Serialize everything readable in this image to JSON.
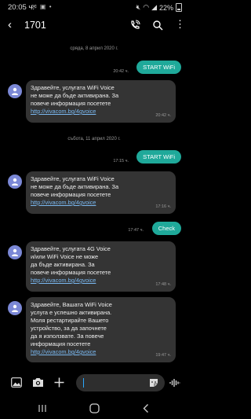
{
  "status": {
    "time": "20:05 ч.",
    "battery": "22%"
  },
  "header": {
    "back_glyph": "‹",
    "title": "1701"
  },
  "conversation": {
    "date1": "сряда, 8 април 2020 г.",
    "start1": {
      "text": "START WiFi",
      "time": "20:42 ч."
    },
    "msg1": {
      "lines": [
        "Здравейте, услугата WiFi Voice",
        "не може да бъде активирана. За",
        "повече информация посетете"
      ],
      "link": "http://vivacom.bg/4gvoice",
      "time": "20:42 ч."
    },
    "date2": "събота, 11 април 2020 г.",
    "start2": {
      "text": "START WiFi",
      "time": "17:15 ч."
    },
    "msg2": {
      "lines": [
        "Здравейте, услугата WiFi Voice",
        "не може да бъде активирана. За",
        "повече информация посетете"
      ],
      "link": "http://vivacom.bg/4gvoice",
      "time": "17:16 ч."
    },
    "check": {
      "text": "Check",
      "time": "17:47 ч."
    },
    "msg3": {
      "lines": [
        "Здравейте, услугата 4G Voice",
        "и/или WiFi Voice  не може",
        "да бъде активирана. За",
        "повече информация посетете"
      ],
      "link": "http://vivacom.bg/4gvoice",
      "time": "17:48 ч."
    },
    "msg4": {
      "lines": [
        "Здравейте, Вашата WiFi Voice",
        "услуга е успешно активирана.",
        "Моля рестартирайте Вашето",
        "устройство, за да започнете",
        "да я използвате. За повече",
        "информация посетете"
      ],
      "link": "http://vivacom.bg/4gvoice",
      "time": "19:47 ч."
    }
  },
  "icons": {
    "back": "back-arrow-icon",
    "call": "wifi-call-icon",
    "search": "search-icon",
    "more": "more-vert-icon",
    "gallery": "gallery-icon",
    "camera": "camera-icon",
    "add": "plus-icon",
    "sticker": "sticker-icon",
    "voice": "voice-wave-icon"
  },
  "colors": {
    "outgoing": "#1fa99a",
    "incoming": "#343434",
    "avatar": "#7b88d6",
    "link": "#7ab8f0",
    "cursor": "#2aa8ff"
  }
}
